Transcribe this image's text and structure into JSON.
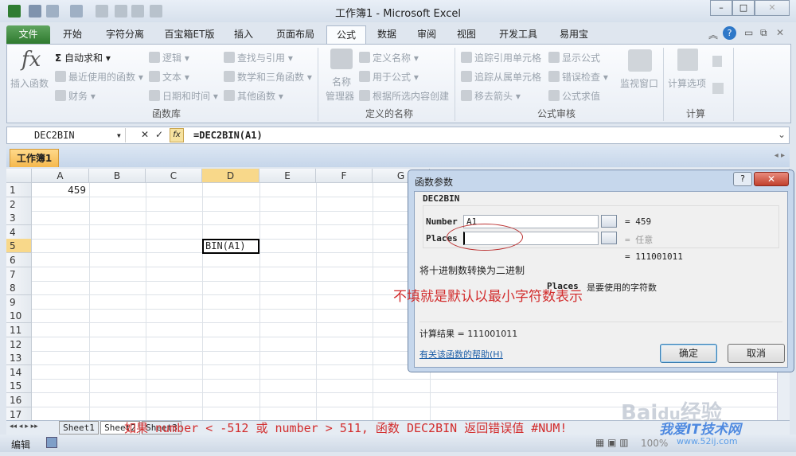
{
  "window": {
    "title": "工作簿1 - Microsoft Excel"
  },
  "tabs": [
    "文件",
    "开始",
    "字符分离",
    "百宝箱ET版",
    "插入",
    "页面布局",
    "公式",
    "数据",
    "审阅",
    "视图",
    "开发工具",
    "易用宝"
  ],
  "ribbon": {
    "insert_function": "插入函数",
    "autosum": "自动求和",
    "recent": "最近使用的函数",
    "financial": "财务",
    "logical": "逻辑",
    "text": "文本",
    "datetime": "日期和时间",
    "lookup": "查找与引用",
    "math": "数学和三角函数",
    "more": "其他函数",
    "group_library": "函数库",
    "name_manager_1": "名称",
    "name_manager_2": "管理器",
    "define_name": "定义名称",
    "use_in_formula": "用于公式",
    "create_from_selection": "根据所选内容创建",
    "group_names": "定义的名称",
    "trace_precedents": "追踪引用单元格",
    "trace_dependents": "追踪从属单元格",
    "remove_arrows": "移去箭头",
    "show_formulas": "显示公式",
    "error_checking": "错误检查",
    "evaluate_formula": "公式求值",
    "watch_window": "监视窗口",
    "group_audit": "公式审核",
    "calc_options": "计算选项",
    "group_calc": "计算"
  },
  "formula_bar": {
    "name_box": "DEC2BIN",
    "formula": "=DEC2BIN(A1)"
  },
  "workbook_tab": "工作簿1",
  "columns": [
    "A",
    "B",
    "C",
    "D",
    "E",
    "F",
    "G"
  ],
  "rows": [
    "1",
    "2",
    "3",
    "4",
    "5",
    "6",
    "7",
    "8",
    "9",
    "10",
    "11",
    "12",
    "13",
    "14",
    "15",
    "16",
    "17"
  ],
  "cells": {
    "A1": "459",
    "D5": "BIN(A1)"
  },
  "sheets": [
    "Sheet1",
    "Sheet2",
    "Sheet3"
  ],
  "status": {
    "mode": "编辑",
    "zoom": "100%"
  },
  "dialog": {
    "title": "函数参数",
    "function": "DEC2BIN",
    "arg1_label": "Number",
    "arg1_value": "A1",
    "arg1_result": "= 459",
    "arg2_label": "Places",
    "arg2_value": "",
    "arg2_result": "= 任意",
    "result_preview": "= 111001011",
    "description": "将十进制数转换为二进制",
    "arg_help_name": "Places",
    "arg_help": "是要使用的字符数",
    "calc_result": "计算结果 =  111001011",
    "help_link": "有关该函数的帮助(H)",
    "ok": "确定",
    "cancel": "取消"
  },
  "annotations": {
    "note1": "不填就是默认以最小字符数表示",
    "note2": "如果 number < -512 或 number > 511, 函数 DEC2BIN 返回错误值 #NUM!"
  },
  "watermark": {
    "brand": "Baidu经验",
    "site": "我爱IT技术网",
    "url": "www.52ij.com"
  }
}
